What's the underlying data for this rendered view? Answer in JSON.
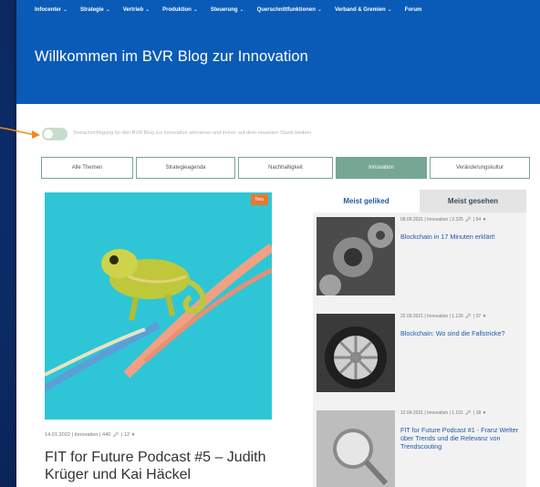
{
  "nav": {
    "items": [
      {
        "label": "Infocenter",
        "has_caret": true
      },
      {
        "label": "Strategie",
        "has_caret": true
      },
      {
        "label": "Vertrieb",
        "has_caret": true
      },
      {
        "label": "Produktion",
        "has_caret": true
      },
      {
        "label": "Steuerung",
        "has_caret": true
      },
      {
        "label": "Querschnittfunktionen",
        "has_caret": true
      },
      {
        "label": "Verband & Gremien",
        "has_caret": true
      },
      {
        "label": "Forum",
        "has_caret": false
      }
    ],
    "caret": "⌄"
  },
  "header": {
    "title": "Willkommen im BVR Blog zur Innovation"
  },
  "notification": {
    "label": "Benachrichtigung für den BVR Blog zur Innovation aktivieren und immer auf dem neuesten Stand bleiben."
  },
  "tabs": [
    {
      "label": "Alle Themen",
      "active": false
    },
    {
      "label": "Strategieagenda",
      "active": false
    },
    {
      "label": "Nachhaltigkeit",
      "active": false
    },
    {
      "label": "Innovation",
      "active": true
    },
    {
      "label": "Veränderungskultur",
      "active": false
    }
  ],
  "featured": {
    "badge": "Neu",
    "date": "14.01.2022",
    "category": "Innovation",
    "views": "440",
    "likes": "12",
    "title": "FIT for Future Podcast #5 – Judith Krüger und Kai Häckel"
  },
  "sidebar": {
    "tab_liked": "Meist geliked",
    "tab_viewed": "Meist gesehen",
    "items": [
      {
        "date": "08.09.2021",
        "category": "Innovation",
        "views": "2.325",
        "likes": "54",
        "title": "Blockchain in 17 Minuten erklärt!"
      },
      {
        "date": "22.09.2021",
        "category": "Innovation",
        "views": "1.126",
        "likes": "37",
        "title": "Blockchain: Wo sind die Fallstricke?"
      },
      {
        "date": "12.04.2021",
        "category": "Innovation",
        "views": "1.101",
        "likes": "18",
        "title": "FIT for Future Podcast #1 - Franz Welter über Trends und die Relevanz von Trendscouting"
      }
    ]
  },
  "colors": {
    "header_blue": "#0a5bb7",
    "accent_green": "#76a694",
    "badge_orange": "#e8792e",
    "link_blue": "#1e5aa8",
    "arrow_orange": "#f08a1c"
  },
  "icons": {
    "views": "key-icon",
    "likes": "heart-icon"
  }
}
